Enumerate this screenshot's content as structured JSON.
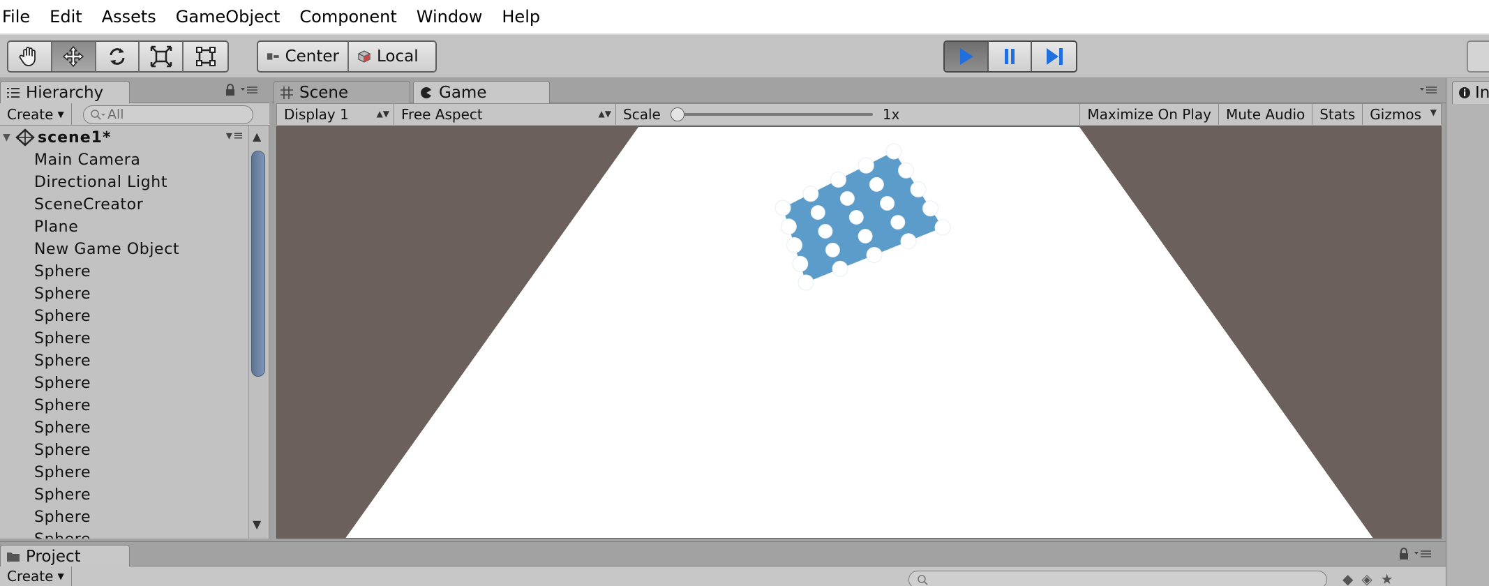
{
  "menu": [
    "File",
    "Edit",
    "Assets",
    "GameObject",
    "Component",
    "Window",
    "Help"
  ],
  "toolbar": {
    "tools": [
      {
        "name": "hand-tool",
        "icon": "hand-icon",
        "active": false
      },
      {
        "name": "move-tool",
        "icon": "move-arrows-icon",
        "active": true
      },
      {
        "name": "rotate-tool",
        "icon": "rotate-icon",
        "active": false
      },
      {
        "name": "scale-tool",
        "icon": "scale-icon",
        "active": false
      },
      {
        "name": "rect-tool",
        "icon": "rect-icon",
        "active": false
      }
    ],
    "pivot_label": "Center",
    "space_label": "Local",
    "play_controls": [
      "play",
      "pause",
      "step"
    ]
  },
  "hierarchy": {
    "tab_label": "Hierarchy",
    "create_label": "Create",
    "search_placeholder": "All",
    "scene_name": "scene1*",
    "items": [
      "Main Camera",
      "Directional Light",
      "SceneCreator",
      "Plane",
      "New Game Object",
      "Sphere",
      "Sphere",
      "Sphere",
      "Sphere",
      "Sphere",
      "Sphere",
      "Sphere",
      "Sphere",
      "Sphere",
      "Sphere",
      "Sphere",
      "Sphere",
      "Sphere"
    ]
  },
  "view_tabs": {
    "scene_label": "Scene",
    "game_label": "Game"
  },
  "game_toolbar": {
    "display": "Display 1",
    "aspect": "Free Aspect",
    "scale_label": "Scale",
    "scale_value": "1x",
    "scale_fraction": 0.0,
    "maximize_label": "Maximize On Play",
    "mute_label": "Mute Audio",
    "stats_label": "Stats",
    "gizmos_label": "Gizmos"
  },
  "inspector": {
    "tab_label": "In"
  },
  "project": {
    "tab_label": "Project",
    "create_label": "Create"
  },
  "colors": {
    "menu_bg": "#ffffff",
    "toolbar_bg": "#c3c3c3",
    "panel_bg": "#c2c2c2",
    "game_background": "#6b605b",
    "plane": "#ffffff",
    "cloth": "#5b9ccb",
    "play_blue": "#1f6fe0"
  }
}
